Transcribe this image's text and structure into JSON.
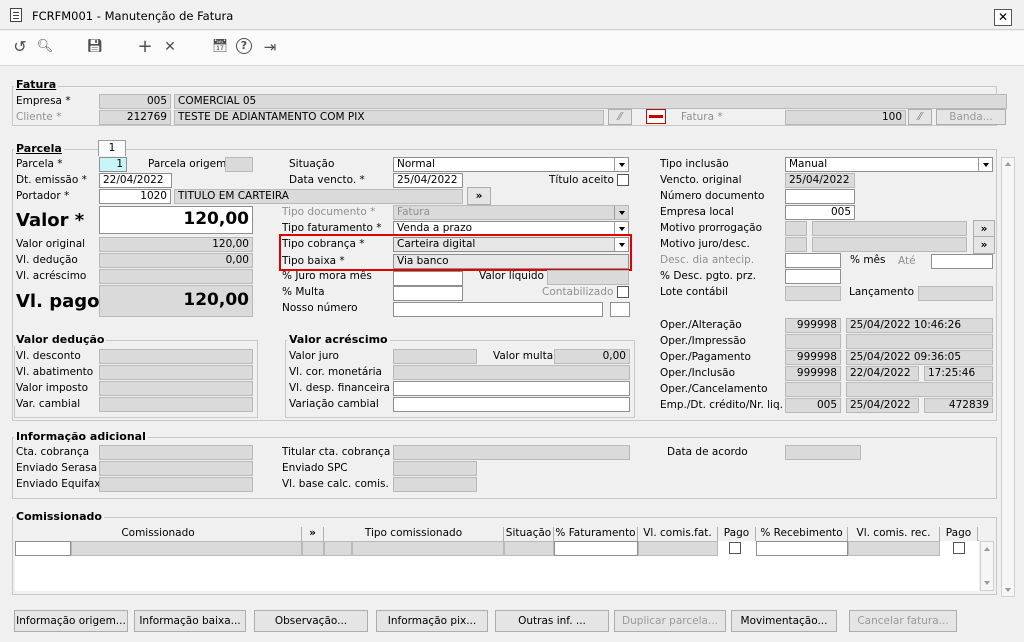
{
  "window": {
    "title": "FCRFM001 - Manutenção de Fatura",
    "close": "✕"
  },
  "toolbar": {
    "refresh": "↺",
    "search": "🔍︎",
    "save": "💾︎",
    "add": "+",
    "remove": "✕",
    "calendar": "📅︎",
    "help": "?",
    "exit": "⇥"
  },
  "fatura": {
    "title": "Fatura",
    "empresa_label": "Empresa *",
    "empresa_code": "005",
    "empresa_name": "COMERCIAL 05",
    "cliente_label": "Cliente *",
    "cliente_code": "212769",
    "cliente_name": "TESTE DE ADIANTAMENTO COM PIX",
    "fatura_label": "Fatura *",
    "fatura_value": "100",
    "banda_label": "Banda..."
  },
  "parcela": {
    "title": "Parcela",
    "tab": "1",
    "parcela_label": "Parcela *",
    "parcela_value": "1",
    "origem_label": "Parcela origem",
    "emissao_label": "Dt. emissão *",
    "emissao_value": "22/04/2022",
    "portador_label": "Portador *",
    "portador_code": "1020",
    "portador_name": "TITULO EM CARTEIRA",
    "valor_label": "Valor *",
    "valor_value": "120,00",
    "valor_original_label": "Valor original",
    "valor_original_value": "120,00",
    "deducao_label": "Vl. dedução",
    "deducao_value": "0,00",
    "acrescimo_label": "Vl. acréscimo",
    "pago_label": "Vl. pago",
    "pago_value": "120,00"
  },
  "mid": {
    "situacao_label": "Situação",
    "situacao_value": "Normal",
    "vencto_label": "Data vencto. *",
    "vencto_value": "25/04/2022",
    "titulo_aceito_label": "Título aceito",
    "tipo_doc_label": "Tipo documento *",
    "tipo_doc_value": "Fatura",
    "tipo_fat_label": "Tipo faturamento *",
    "tipo_fat_value": "Venda a prazo",
    "tipo_cob_label": "Tipo cobrança *",
    "tipo_cob_value": "Carteira digital",
    "tipo_baixa_label": "Tipo baixa *",
    "tipo_baixa_value": "Via banco",
    "juro_label": "% Juro mora mês",
    "valor_liquido_label": "Valor líquido",
    "multa_label": "% Multa",
    "contabilizado_label": "Contabilizado",
    "nosso_label": "Nosso número",
    "more": "»"
  },
  "right": {
    "tipo_inclusao_label": "Tipo inclusão",
    "tipo_inclusao_value": "Manual",
    "vencto_orig_label": "Vencto. original",
    "vencto_orig_value": "25/04/2022",
    "num_doc_label": "Número documento",
    "emp_local_label": "Empresa local",
    "emp_local_value": "005",
    "motivo_prorr_label": "Motivo prorrogação",
    "motivo_juro_label": "Motivo juro/desc.",
    "desc_dia_label": "Desc. dia antecip.",
    "pct_mes_label": "% mês",
    "ate_label": "Até",
    "desc_pgto_label": "% Desc. pgto. prz.",
    "lote_label": "Lote contábil",
    "lancamento_label": "Lançamento",
    "more": "»"
  },
  "oper": {
    "alteracao_label": "Oper./Alteração",
    "alteracao_user": "999998",
    "alteracao_dt": "25/04/2022 10:46:26",
    "impressao_label": "Oper./Impressão",
    "pagamento_label": "Oper./Pagamento",
    "pagamento_user": "999998",
    "pagamento_dt": "25/04/2022 09:36:05",
    "inclusao_label": "Oper./Inclusão",
    "inclusao_user": "999998",
    "inclusao_date": "22/04/2022",
    "inclusao_time": "17:25:46",
    "cancelamento_label": "Oper./Cancelamento",
    "emp_credito_label": "Emp./Dt. crédito/Nr. liq.",
    "emp_credito_emp": "005",
    "emp_credito_dt": "25/04/2022",
    "emp_credito_nr": "472839"
  },
  "deducao": {
    "title": "Valor dedução",
    "desconto_label": "Vl. desconto",
    "abatimento_label": "Vl. abatimento",
    "imposto_label": "Valor imposto",
    "cambial_label": "Var. cambial"
  },
  "acrescimo": {
    "title": "Valor acréscimo",
    "juro_label": "Valor juro",
    "multa_label": "Valor multa",
    "multa_value": "0,00",
    "monetaria_label": "Vl. cor. monetária",
    "financeira_label": "Vl. desp. financeira",
    "cambial_label": "Variação cambial"
  },
  "info": {
    "title": "Informação adicional",
    "cta_label": "Cta. cobrança",
    "serasa_label": "Enviado Serasa",
    "equifax_label": "Enviado Equifax",
    "titular_label": "Titular cta. cobrança",
    "spc_label": "Enviado SPC",
    "base_label": "Vl. base calc. comis.",
    "acordo_label": "Data de acordo"
  },
  "comissionado": {
    "title": "Comissionado",
    "columns": {
      "comissionado": "Comissionado",
      "more": "»",
      "tipo": "Tipo comissionado",
      "situacao": "Situação",
      "pct_fat": "% Faturamento",
      "vl_fat": "Vl. comis.fat.",
      "pago1": "Pago",
      "pct_rec": "% Recebimento",
      "vl_rec": "Vl. comis. rec.",
      "pago2": "Pago"
    }
  },
  "buttons": {
    "origem": "Informação origem...",
    "baixa": "Informação baixa...",
    "obs": "Observação...",
    "pix": "Informação pix...",
    "outras": "Outras inf. ...",
    "duplicar": "Duplicar parcela...",
    "mov": "Movimentação...",
    "cancelar": "Cancelar fatura..."
  },
  "colors": {
    "highlight": "#e00000",
    "accent": "#c8f6f8"
  }
}
